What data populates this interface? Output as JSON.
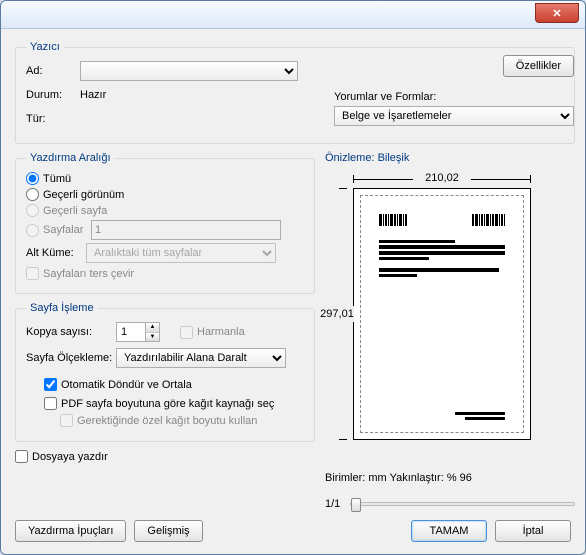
{
  "titlebar": {
    "text": ""
  },
  "printer": {
    "legend": "Yazıcı",
    "name_label": "Ad:",
    "name_value": "",
    "status_label": "Durum:",
    "status_value": "Hazır",
    "type_label": "Tür:",
    "type_value": "",
    "properties_btn": "Özellikler"
  },
  "comments": {
    "label": "Yorumlar ve Formlar:",
    "value": "Belge ve İşaretlemeler"
  },
  "range": {
    "legend": "Yazdırma Aralığı",
    "all": "Tümü",
    "current_view": "Geçerli görünüm",
    "current_page": "Geçerli sayfa",
    "pages": "Sayfalar",
    "pages_value": "1",
    "subset_label": "Alt Küme:",
    "subset_value": "Aralıktaki tüm sayfalar",
    "reverse": "Sayfaları ters çevir"
  },
  "handling": {
    "legend": "Sayfa İşleme",
    "copies_label": "Kopya sayısı:",
    "copies_value": "1",
    "collate": "Harmanla",
    "scaling_label": "Sayfa Ölçekleme:",
    "scaling_value": "Yazdırılabilir Alana Daralt",
    "auto_rotate": "Otomatik Döndür ve Ortala",
    "paper_source": "PDF sayfa boyutuna göre kağıt kaynağı seç",
    "custom_paper": "Gerektiğinde özel kağıt boyutu kullan"
  },
  "print_to_file": "Dosyaya yazdır",
  "preview": {
    "label": "Önizleme: Bileşik",
    "width": "210,02",
    "height": "297,01",
    "units_line": "Birimler: mm Yakınlaştır: % 96",
    "page_indicator": "1/1"
  },
  "footer": {
    "tips": "Yazdırma İpuçları",
    "advanced": "Gelişmiş",
    "ok": "TAMAM",
    "cancel": "İptal"
  }
}
